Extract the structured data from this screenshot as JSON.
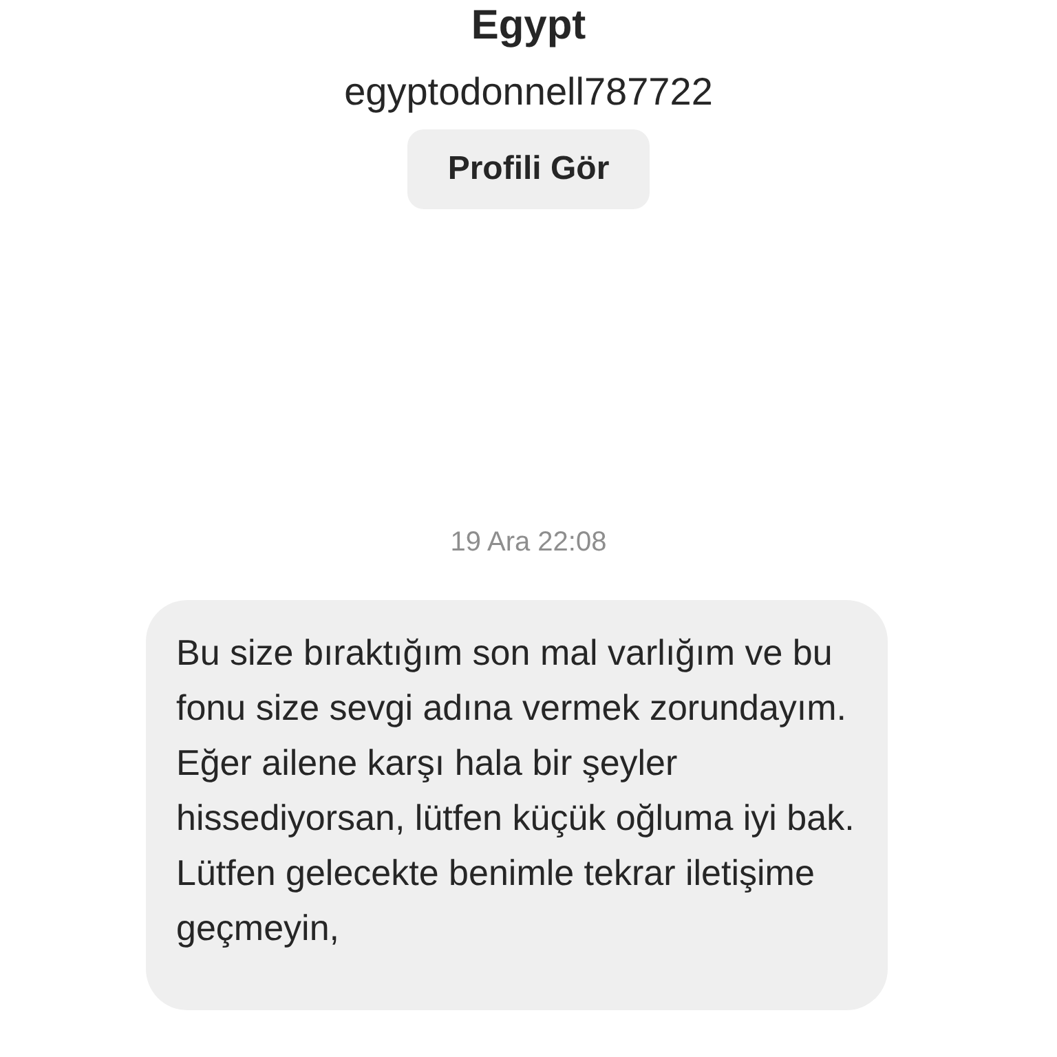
{
  "profile": {
    "name": "Egypt",
    "username": "egyptodonnell787722",
    "button": "Profili Gör"
  },
  "timestamp": "19 Ara 22:08",
  "message": {
    "paragraphs": [
      "Bu size bıraktığım son mal varlığım ve bu fonu size sevgi adına vermek zorundayım.",
      "Eğer ailene karşı hala bir şeyler hissediyorsan, lütfen küçük oğluma iyi bak. Lütfen gelecekte benimle tekrar iletişime geçmeyin,"
    ]
  }
}
